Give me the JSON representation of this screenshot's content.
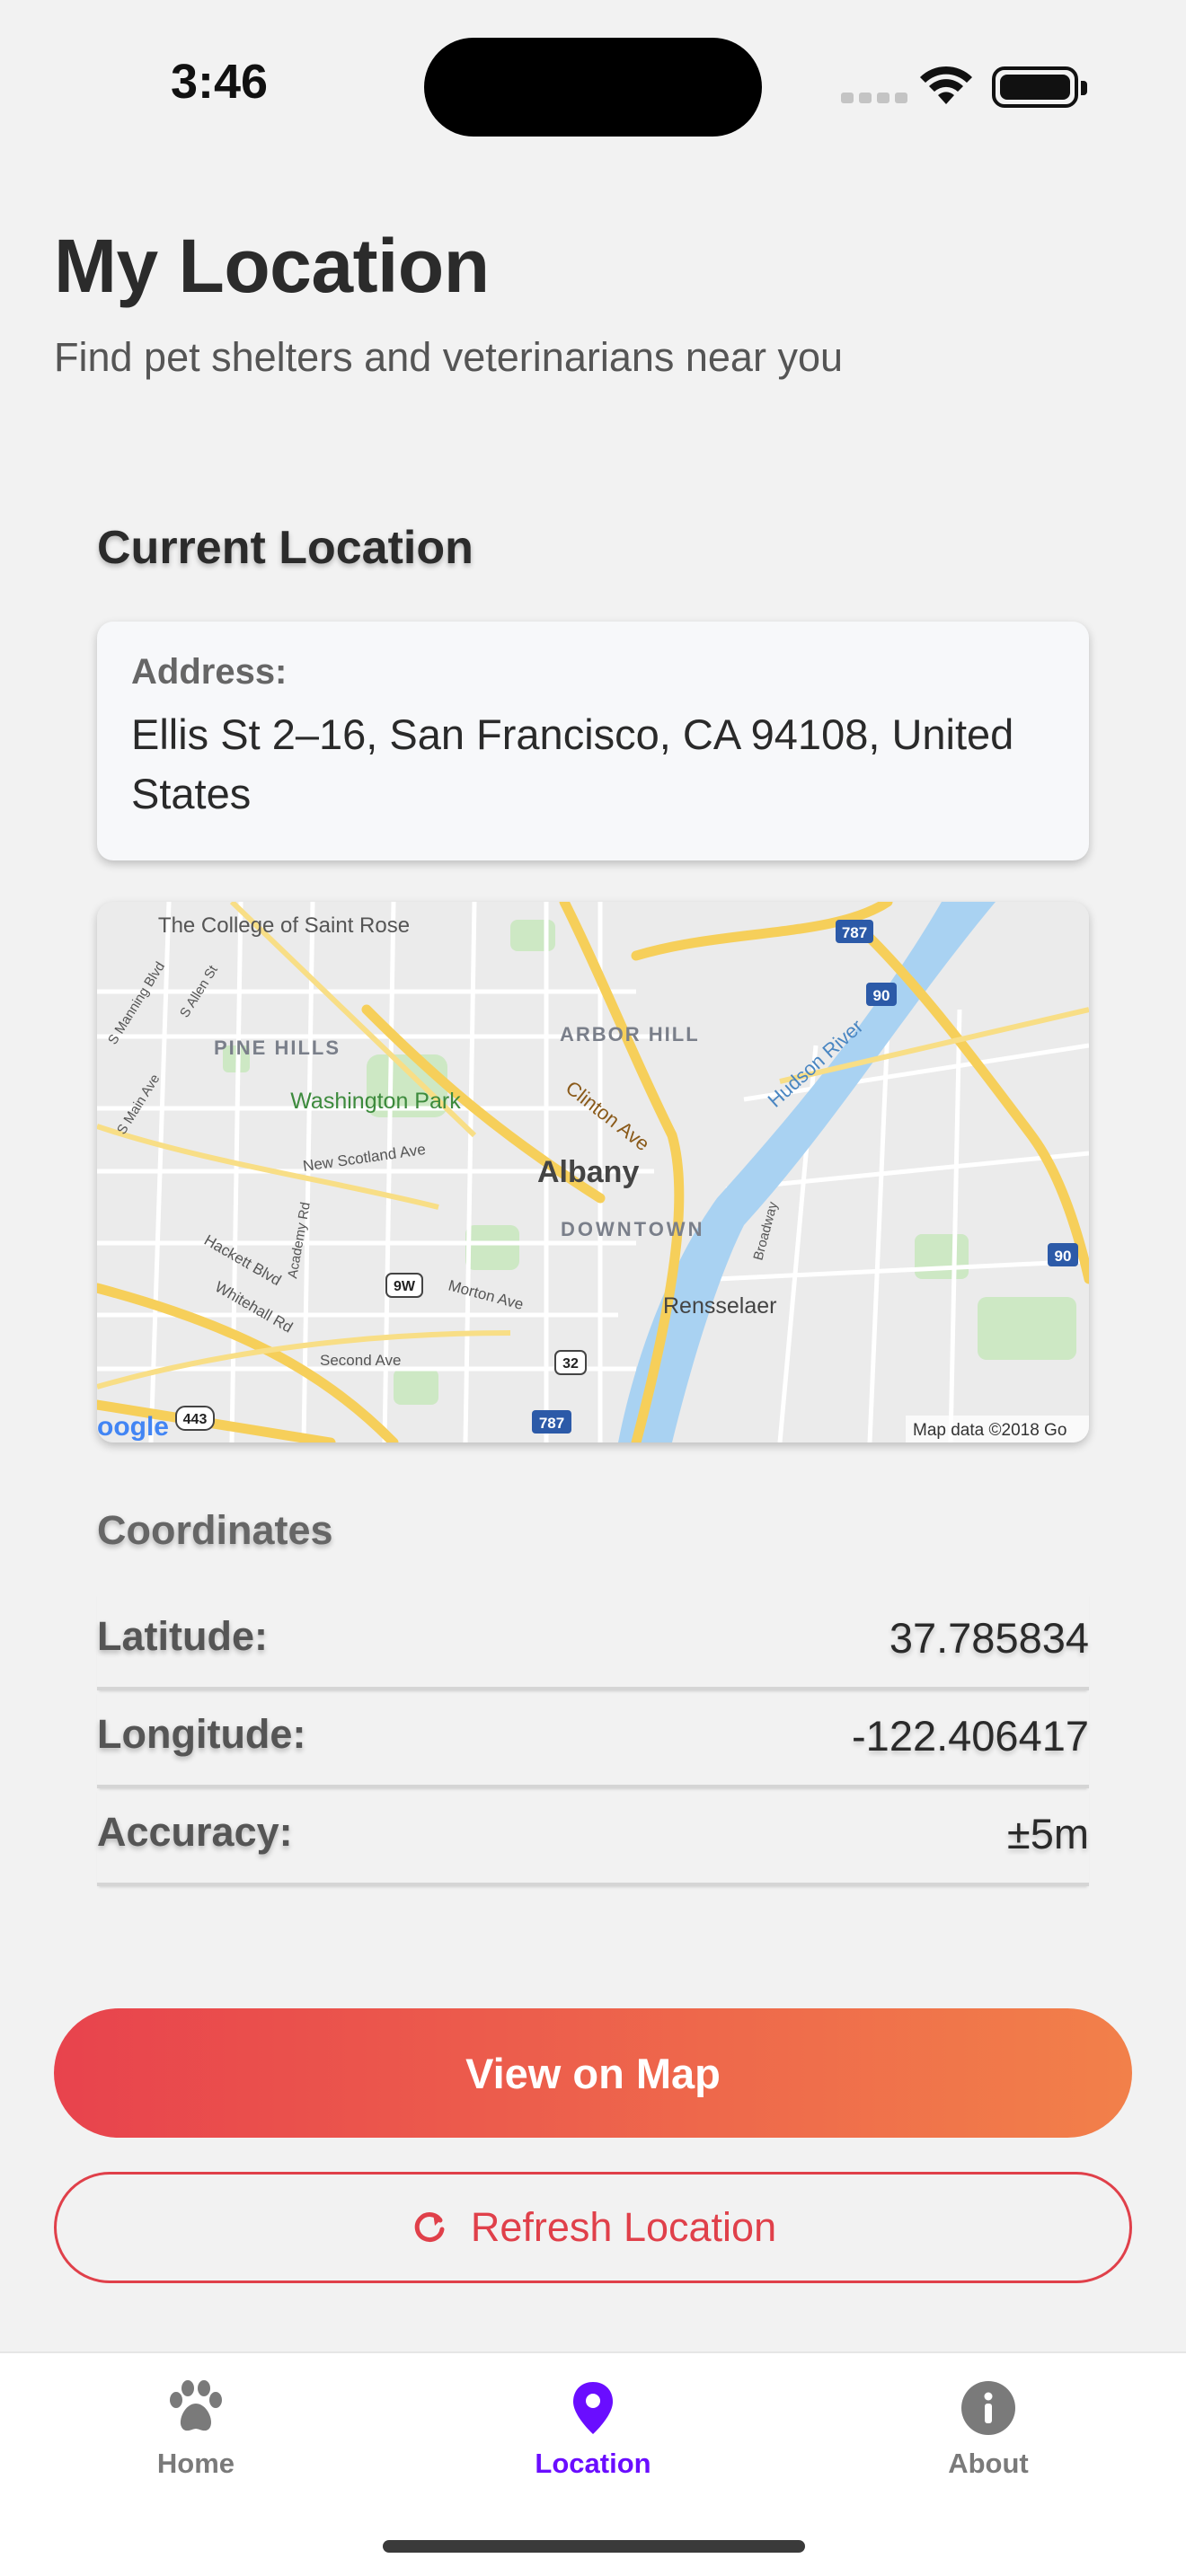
{
  "status": {
    "time": "3:46"
  },
  "header": {
    "title": "My Location",
    "subtitle": "Find pet shelters and veterinarians near you"
  },
  "current_location": {
    "heading": "Current Location",
    "address_label": "Address:",
    "address_value": "Ellis St 2–16, San Francisco, CA 94108, United States"
  },
  "map": {
    "labels": {
      "college": "The College of Saint Rose",
      "pine_hills": "PINE HILLS",
      "arbor_hill": "ARBOR HILL",
      "washington_park": "Washington Park",
      "clinton_ave": "Clinton Ave",
      "albany": "Albany",
      "downtown": "DOWNTOWN",
      "hudson_river": "Hudson River",
      "rensselaer": "Rensselaer",
      "new_scotland": "New Scotland Ave",
      "morton_ave": "Morton Ave",
      "second_ave": "Second Ave",
      "broadway": "Broadway",
      "hackett": "Hackett Blvd",
      "whitehall": "Whitehall Rd",
      "academy": "Academy Rd",
      "s_manning": "S Manning Blvd",
      "s_allen": "S Allen St",
      "s_main": "S Main Ave",
      "attribution": "Map data ©2018 Go",
      "logo": "oogle"
    },
    "shields": [
      "787",
      "90",
      "90",
      "9W",
      "32",
      "787",
      "443"
    ]
  },
  "coordinates": {
    "heading": "Coordinates",
    "rows": [
      {
        "label": "Latitude:",
        "value": "37.785834"
      },
      {
        "label": "Longitude:",
        "value": "-122.406417"
      },
      {
        "label": "Accuracy:",
        "value": "±5m"
      }
    ]
  },
  "actions": {
    "view_on_map": "View on Map",
    "refresh_location": "Refresh Location"
  },
  "tabs": [
    {
      "label": "Home",
      "icon": "paw-icon",
      "active": false
    },
    {
      "label": "Location",
      "icon": "map-pin-icon",
      "active": true
    },
    {
      "label": "About",
      "icon": "info-icon",
      "active": false
    }
  ],
  "colors": {
    "accent": "#6a0dff",
    "primary_start": "#e8434d",
    "primary_end": "#f2804a",
    "outline": "#e0404a"
  }
}
